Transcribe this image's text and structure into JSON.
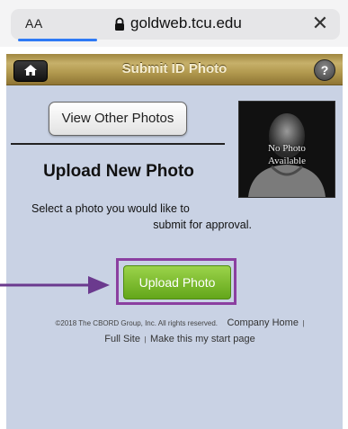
{
  "browser": {
    "text_size_label": "AA",
    "url": "goldweb.tcu.edu",
    "close_label": "✕",
    "load_progress": 0.24
  },
  "header": {
    "title": "Submit ID Photo",
    "help_label": "?"
  },
  "main": {
    "view_other_label": "View Other Photos",
    "photo_placeholder_line1": "No Photo",
    "photo_placeholder_line2": "Available",
    "heading": "Upload New Photo",
    "instructions_line1": "Select a photo you would like to",
    "instructions_line2": "submit for approval.",
    "upload_label": "Upload Photo"
  },
  "footer": {
    "copyright": "©2018 The CBORD Group, Inc. All rights reserved.",
    "company_home": "Company Home",
    "separator": "|",
    "full_site": "Full Site",
    "start_page": "Make this my start page"
  },
  "colors": {
    "header_gold": "#b29a4f",
    "content_bg": "#c9d2e4",
    "upload_green": "#7cbe2f",
    "annotation_purple": "#8b3fa0",
    "progress_blue": "#2f7af5"
  }
}
